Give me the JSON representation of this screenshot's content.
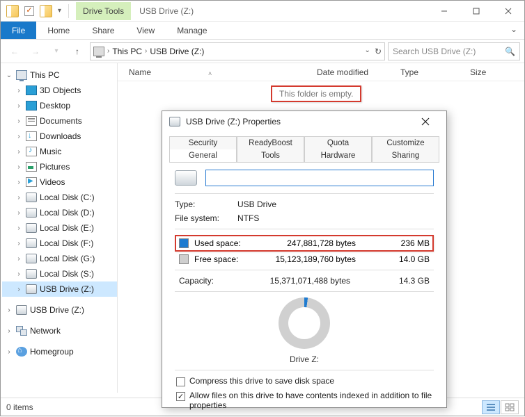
{
  "window": {
    "drive_tools": "Drive Tools",
    "tab_title": "USB Drive (Z:)"
  },
  "ribbon": {
    "file": "File",
    "home": "Home",
    "share": "Share",
    "view": "View",
    "manage": "Manage"
  },
  "breadcrumb": {
    "this_pc": "This PC",
    "location": "USB Drive (Z:)"
  },
  "search": {
    "placeholder": "Search USB Drive (Z:)"
  },
  "tree": {
    "this_pc": "This PC",
    "items": [
      "3D Objects",
      "Desktop",
      "Documents",
      "Downloads",
      "Music",
      "Pictures",
      "Videos",
      "Local Disk (C:)",
      "Local Disk (D:)",
      "Local Disk (E:)",
      "Local Disk (F:)",
      "Local Disk (G:)",
      "Local Disk (S:)",
      "USB Drive (Z:)"
    ],
    "usb": "USB Drive (Z:)",
    "network": "Network",
    "homegroup": "Homegroup"
  },
  "columns": {
    "name": "Name",
    "date": "Date modified",
    "type": "Type",
    "size": "Size"
  },
  "empty": "This folder is empty.",
  "status": {
    "count": "0 items"
  },
  "dialog": {
    "title": "USB Drive (Z:) Properties",
    "tabs": {
      "security": "Security",
      "readyboost": "ReadyBoost",
      "quota": "Quota",
      "customize": "Customize",
      "general": "General",
      "tools": "Tools",
      "hardware": "Hardware",
      "sharing": "Sharing"
    },
    "type_label": "Type:",
    "type_value": "USB Drive",
    "fs_label": "File system:",
    "fs_value": "NTFS",
    "used_label": "Used space:",
    "used_bytes": "247,881,728 bytes",
    "used_h": "236 MB",
    "free_label": "Free space:",
    "free_bytes": "15,123,189,760 bytes",
    "free_h": "14.0 GB",
    "cap_label": "Capacity:",
    "cap_bytes": "15,371,071,488 bytes",
    "cap_h": "14.3 GB",
    "drive_label": "Drive Z:",
    "compress": "Compress this drive to save disk space",
    "index": "Allow files on this drive to have contents indexed in addition to file properties"
  }
}
